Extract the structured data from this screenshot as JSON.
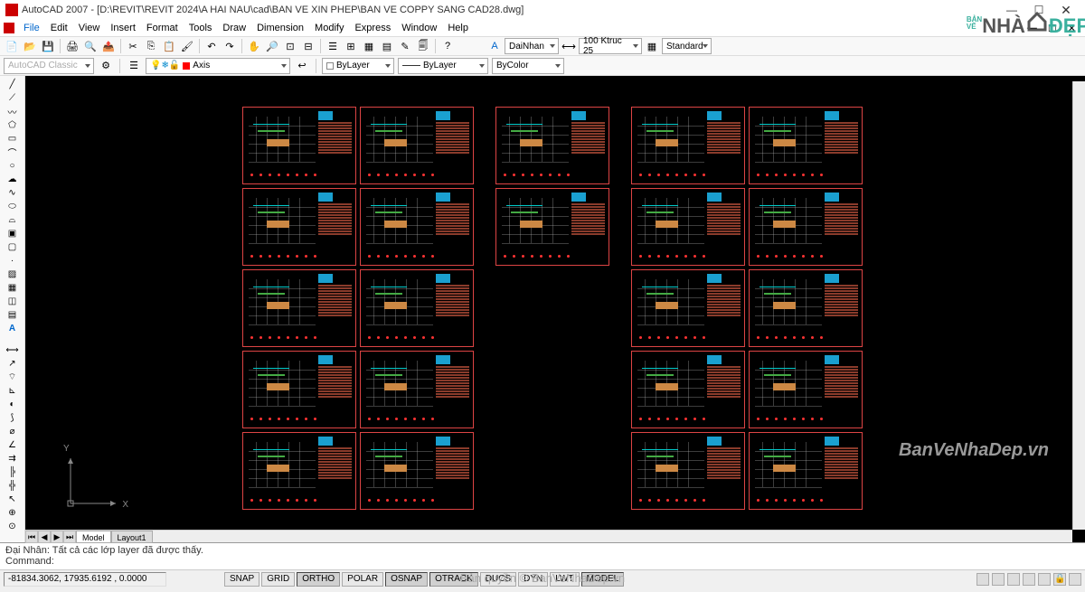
{
  "title": "AutoCAD 2007 - [D:\\REVIT\\REVIT 2024\\A HAI NAU\\cad\\BAN VE XIN PHEP\\BAN VE COPPY SANG CAD28.dwg]",
  "menu": [
    "File",
    "Edit",
    "View",
    "Insert",
    "Format",
    "Tools",
    "Draw",
    "Dimension",
    "Modify",
    "Express",
    "Window",
    "Help"
  ],
  "layer_combo": "AutoCAD Classic",
  "layer_name": "Axis",
  "color_combo": "ByLayer",
  "linetype_combo": "ByLayer",
  "lineweight_combo": "ByColor",
  "textstyle_combo": "DaiNhan",
  "dimstyle_combo": "100 Ktruc 25",
  "table_combo": "Standard",
  "tabs": {
    "model": "Model",
    "layout1": "Layout1"
  },
  "cmd_line1": "Đại Nhân: Tất cả các lớp layer đã được thấy.",
  "cmd_line2": "Command:",
  "coords": "-81834.3062, 17935.6192 , 0.0000",
  "status_buttons": [
    "SNAP",
    "GRID",
    "ORTHO",
    "POLAR",
    "OSNAP",
    "OTRACK",
    "DUCS",
    "DYN",
    "LWT",
    "MODEL"
  ],
  "status_active": {
    "ORTHO": true,
    "OSNAP": true,
    "OTRACK": true,
    "MODEL": true
  },
  "watermark_site": "BanVeNhaDep.vn",
  "watermark_center": "Bản quyền © BanVeNhaDep.vn",
  "logo_text_1": "BẢN VẼ",
  "logo_text_2": "NHÀ",
  "logo_text_3": "ĐẸP",
  "ucs": {
    "x": "X",
    "y": "Y"
  },
  "sheet_layout": [
    [
      1,
      1,
      0,
      1,
      0,
      1,
      1
    ],
    [
      1,
      1,
      0,
      1,
      0,
      1,
      1
    ],
    [
      1,
      1,
      0,
      0,
      0,
      1,
      1
    ],
    [
      1,
      1,
      0,
      0,
      0,
      1,
      1
    ],
    [
      1,
      1,
      0,
      0,
      0,
      1,
      1
    ]
  ],
  "icons": {
    "new": "new-icon",
    "open": "open-icon",
    "save": "save-icon",
    "print": "print-icon",
    "cut": "cut-icon",
    "copy": "copy-icon",
    "paste": "paste-icon",
    "undo": "undo-icon",
    "redo": "redo-icon",
    "pan": "pan-icon",
    "zoom": "zoom-icon"
  }
}
